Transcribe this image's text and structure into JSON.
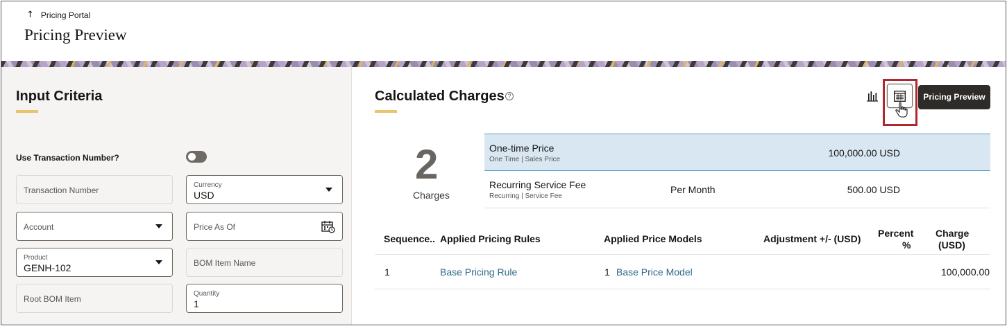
{
  "header": {
    "back_label": "Pricing Portal",
    "title": "Pricing Preview"
  },
  "input_criteria": {
    "title": "Input Criteria",
    "use_transaction_label": "Use Transaction Number?",
    "fields": {
      "transaction_number": {
        "placeholder": "Transaction Number"
      },
      "currency": {
        "label": "Currency",
        "value": "USD"
      },
      "account": {
        "placeholder": "Account"
      },
      "price_as_of": {
        "placeholder": "Price As Of"
      },
      "product": {
        "label": "Product",
        "value": "GENH-102"
      },
      "bom_item_name": {
        "placeholder": "BOM Item Name"
      },
      "root_bom_item": {
        "placeholder": "Root BOM Item"
      },
      "quantity": {
        "label": "Quantity",
        "value": "1"
      }
    }
  },
  "calculated_charges": {
    "title": "Calculated Charges",
    "help": "?",
    "preview_button": "Pricing Preview",
    "count": "2",
    "count_label": "Charges",
    "charges": [
      {
        "name": "One-time Price",
        "sub": "One Time | Sales Price",
        "period": "",
        "amount": "100,000.00 USD"
      },
      {
        "name": "Recurring Service Fee",
        "sub": "Recurring | Service Fee",
        "period": "Per Month",
        "amount": "500.00 USD"
      }
    ],
    "table": {
      "headers": {
        "sequence": "Sequence..",
        "rules": "Applied Pricing Rules",
        "models": "Applied Price Models",
        "adjustment": "Adjustment +/- (USD)",
        "percent_1": "Percent",
        "percent_2": "%",
        "charge_1": "Charge",
        "charge_2": "(USD)"
      },
      "rows": [
        {
          "sequence": "1",
          "rule": "Base Pricing Rule",
          "model_seq": "1",
          "model": "Base Price Model",
          "adjustment": "",
          "percent": "",
          "charge": "100,000.00"
        }
      ]
    }
  },
  "icons": {
    "back": "arrow-up-icon",
    "calendar": "calendar-icon",
    "chart": "bar-chart-icon",
    "grid": "table-view-icon",
    "cursor": "hand-pointer-icon"
  },
  "colors": {
    "accent_underline": "#e8c46a",
    "selected_row": "#d8e7f1",
    "link": "#2c6a8a",
    "highlight_box": "#b0272e",
    "primary_button": "#2e2b28"
  }
}
